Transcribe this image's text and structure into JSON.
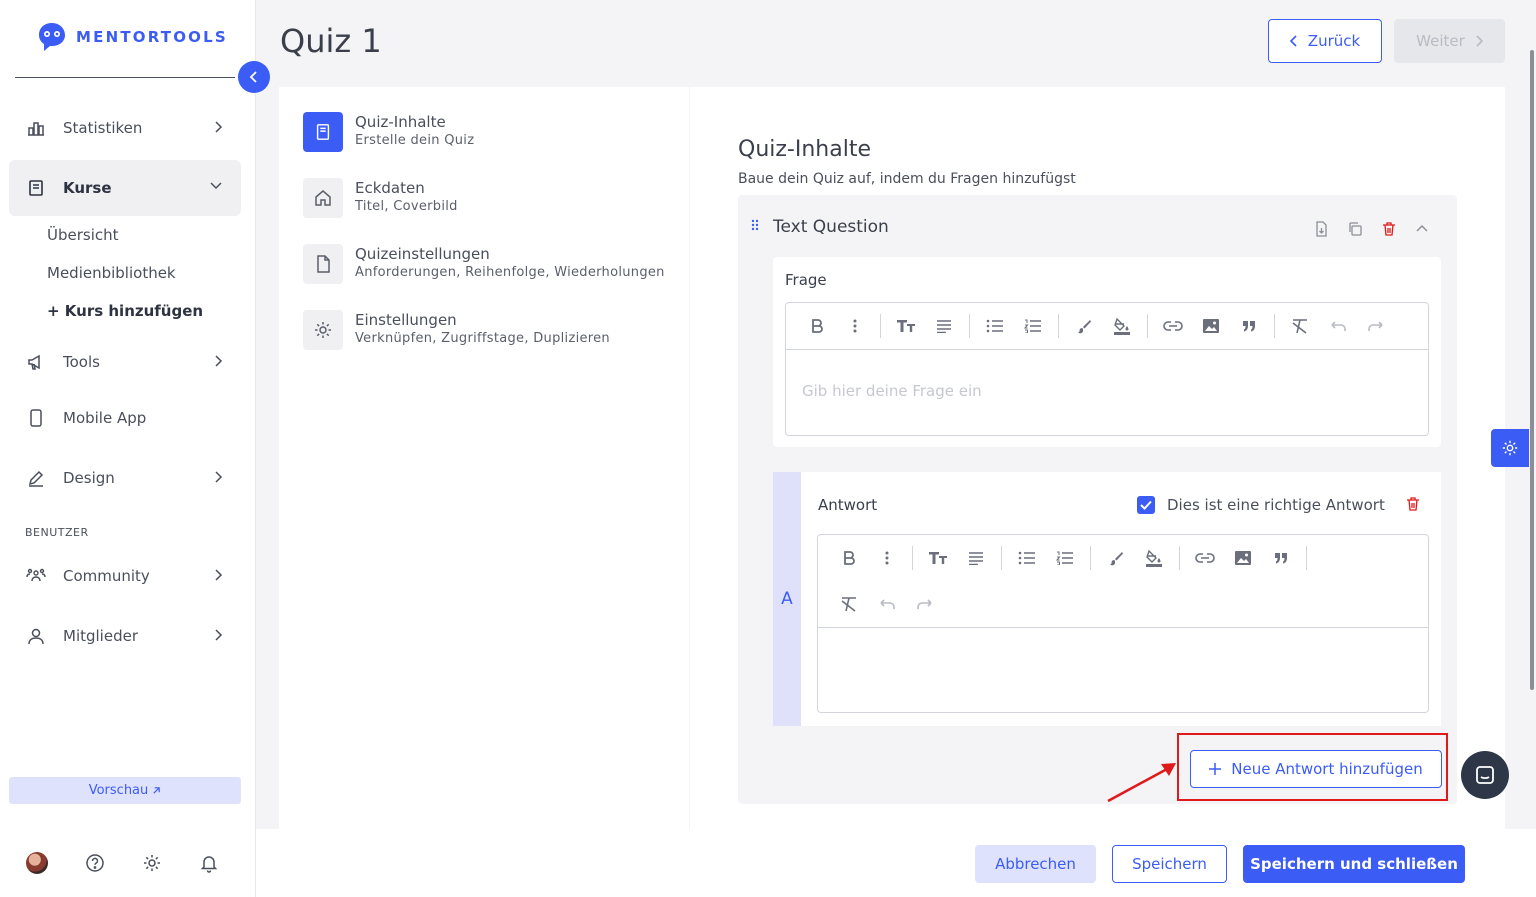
{
  "brand": {
    "name": "MENTORTOOLS",
    "accent": "#3c5cf6"
  },
  "sidebar": {
    "items": [
      {
        "label": "Statistiken",
        "icon": "bar-chart-icon"
      },
      {
        "label": "Kurse",
        "icon": "book-icon",
        "active": true
      },
      {
        "label": "Tools",
        "icon": "megaphone-icon"
      },
      {
        "label": "Mobile App",
        "icon": "mobile-icon"
      },
      {
        "label": "Design",
        "icon": "pencil-icon"
      },
      {
        "label": "Community",
        "icon": "community-icon"
      },
      {
        "label": "Mitglieder",
        "icon": "user-icon"
      }
    ],
    "subitems": [
      "Übersicht",
      "Medienbibliothek",
      "+ Kurs hinzufügen"
    ],
    "section_users": "BENUTZER",
    "preview_label": "Vorschau"
  },
  "header": {
    "title": "Quiz 1",
    "back_label": "Zurück",
    "next_label": "Weiter"
  },
  "steps": [
    {
      "title": "Quiz-Inhalte",
      "subtitle": "Erstelle dein Quiz"
    },
    {
      "title": "Eckdaten",
      "subtitle": "Titel, Coverbild"
    },
    {
      "title": "Quizeinstellungen",
      "subtitle": "Anforderungen, Reihenfolge, Wiederholungen"
    },
    {
      "title": "Einstellungen",
      "subtitle": "Verknüpfen, Zugriffstage, Duplizieren"
    }
  ],
  "content": {
    "title": "Quiz-Inhalte",
    "subtitle": "Baue dein Quiz auf, indem du Fragen hinzufügst",
    "question": {
      "type_label": "Text Question",
      "frage_label": "Frage",
      "frage_placeholder": "Gib hier deine Frage ein",
      "answer": {
        "letter": "A",
        "label": "Antwort",
        "correct_label": "Dies ist eine richtige Antwort",
        "correct_checked": true
      },
      "add_answer_label": "Neue Antwort hinzufügen"
    }
  },
  "footer": {
    "cancel_label": "Abbrechen",
    "save_label": "Speichern",
    "save_close_label": "Speichern und schließen"
  }
}
